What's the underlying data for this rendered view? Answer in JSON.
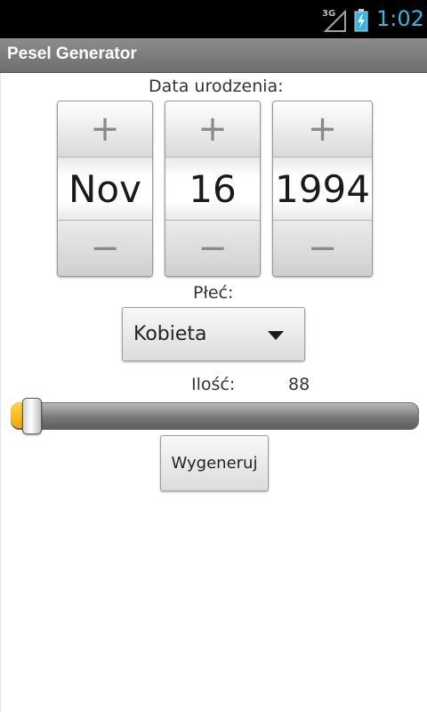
{
  "status_bar": {
    "network_label": "3G",
    "clock": "1:02",
    "clock_color": "#33b5e5",
    "icons": [
      "signal-icon",
      "battery-charging-icon"
    ]
  },
  "title_bar": {
    "title": "Pesel Generator"
  },
  "birth_date": {
    "label": "Data urodzenia:",
    "month": "Nov",
    "day": "16",
    "year": "1994",
    "increment_symbol": "+",
    "decrement_symbol": "−"
  },
  "gender": {
    "label": "Płeć:",
    "selected": "Kobieta"
  },
  "count": {
    "label": "Ilość:",
    "value": "88",
    "slider_fraction": 0.02,
    "accent_color": "#f0a800"
  },
  "generate_button": {
    "label": "Wygeneruj"
  }
}
